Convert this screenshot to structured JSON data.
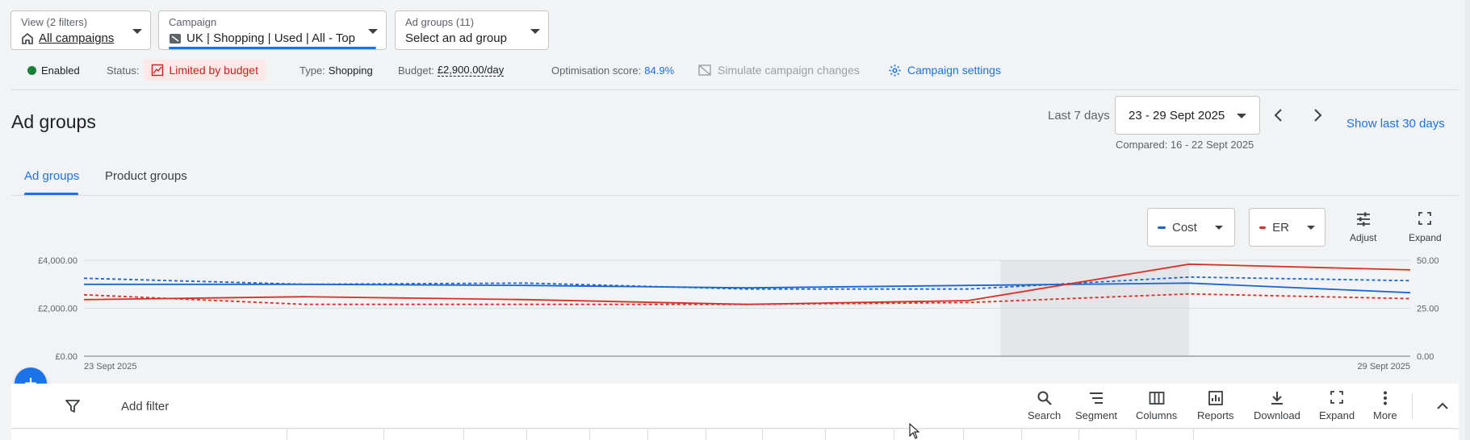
{
  "pickers": {
    "view": {
      "label": "View (2 filters)",
      "value": "All campaigns"
    },
    "campaign": {
      "label": "Campaign",
      "value": "UK | Shopping | Used | All - Top"
    },
    "adgroups": {
      "label": "Ad groups (11)",
      "value": "Select an ad group"
    }
  },
  "status": {
    "enabled": "Enabled",
    "status_label": "Status:",
    "status_value": "Limited by budget",
    "type_label": "Type:",
    "type_value": "Shopping",
    "budget_label": "Budget:",
    "budget_value": "£2,900.00/day",
    "opt_label": "Optimisation score:",
    "opt_value": "84.9%",
    "simulate": "Simulate campaign changes",
    "settings": "Campaign settings"
  },
  "page_title": "Ad groups",
  "date": {
    "preset": "Last 7 days",
    "range": "23 - 29 Sept 2025",
    "compared": "Compared: 16 - 22 Sept 2025",
    "show_last": "Show last 30 days"
  },
  "tabs": [
    {
      "label": "Ad groups",
      "active": true
    },
    {
      "label": "Product groups",
      "active": false
    }
  ],
  "chart_controls": {
    "metric1": "Cost",
    "metric2": "ER",
    "adjust": "Adjust",
    "expand": "Expand"
  },
  "colors": {
    "accent": "#1a73e8",
    "cost": "#1967d2",
    "er": "#d93025",
    "enabled": "#188038"
  },
  "chart_data": {
    "type": "line",
    "x": [
      "23 Sept 2025",
      "24 Sept 2025",
      "25 Sept 2025",
      "26 Sept 2025",
      "27 Sept 2025",
      "28 Sept 2025",
      "29 Sept 2025"
    ],
    "x_tick_labels": [
      "23 Sept 2025",
      "29 Sept 2025"
    ],
    "left_axis": {
      "ticks": [
        "£0.00",
        "£2,000.00",
        "£4,000.00"
      ],
      "ylim": [
        0,
        4000
      ]
    },
    "right_axis": {
      "ticks": [
        "0.00",
        "25.00",
        "50.00"
      ],
      "ylim": [
        0,
        50
      ]
    },
    "highlight_range": [
      "27 Sept 2025",
      "28 Sept 2025"
    ],
    "series": [
      {
        "name": "Cost",
        "axis": "left",
        "style": "solid",
        "color": "#1967d2",
        "values": [
          3000,
          3000,
          2950,
          2850,
          2950,
          3050,
          2650
        ]
      },
      {
        "name": "Cost",
        "axis": "left",
        "style": "dashed",
        "color": "#1967d2",
        "values": [
          3250,
          3000,
          3050,
          2800,
          2800,
          3300,
          3150
        ]
      },
      {
        "name": "ER",
        "axis": "right",
        "style": "solid",
        "color": "#d93025",
        "values": [
          29.5,
          31,
          29.5,
          27,
          29,
          48,
          45
        ]
      },
      {
        "name": "ER",
        "axis": "right",
        "style": "dashed",
        "color": "#d93025",
        "values": [
          32,
          27,
          27,
          27,
          28,
          32.5,
          30
        ]
      }
    ],
    "grid": true
  },
  "toolbar": {
    "add_filter": "Add filter",
    "buttons": [
      "Search",
      "Segment",
      "Columns",
      "Reports",
      "Download",
      "Expand",
      "More"
    ]
  }
}
